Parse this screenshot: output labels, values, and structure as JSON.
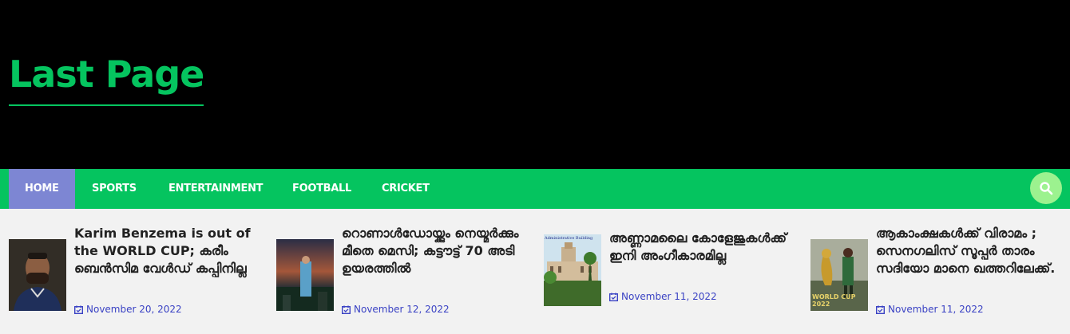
{
  "site": {
    "title": "Last Page"
  },
  "nav": {
    "items": [
      {
        "label": "HOME",
        "active": true
      },
      {
        "label": "SPORTS"
      },
      {
        "label": "ENTERTAINMENT"
      },
      {
        "label": "FOOTBALL"
      },
      {
        "label": "CRICKET"
      }
    ],
    "search_icon": "search-icon"
  },
  "colors": {
    "brand": "#05c45f",
    "header_bg": "#000000",
    "nav_active": "#7d86d3",
    "search_bg": "#9cf28f",
    "date": "#3a42c4"
  },
  "posts": [
    {
      "title": "Karim Benzema is out of the WORLD CUP; കരീം ബെൻസിമ വേൾഡ് കപ്പിനില്ല",
      "date": "November 20, 2022"
    },
    {
      "title": "റൊണാൾഡോയ്ക്കും നെയ്മർക്കും മീതെ മെസി; കട്ടൗട്ട് 70 അടി ഉയരത്തിൽ",
      "date": "November 12, 2022"
    },
    {
      "title": "അണ്ണാമലൈ കോളേജുകൾക്ക് ഇനി അംഗീകാരമില്ല",
      "date": "November 11, 2022",
      "thumb_caption": "Administrative Building"
    },
    {
      "title": "ആകാംക്ഷകൾക്ക് വിരാമം ; സെനഗലിസ് സൂപ്പർ താരം സദിയോ മാനെ ഖത്തറിലേക്ക്.",
      "date": "November 11, 2022",
      "thumb_caption": "WORLD CUP 2022"
    }
  ]
}
